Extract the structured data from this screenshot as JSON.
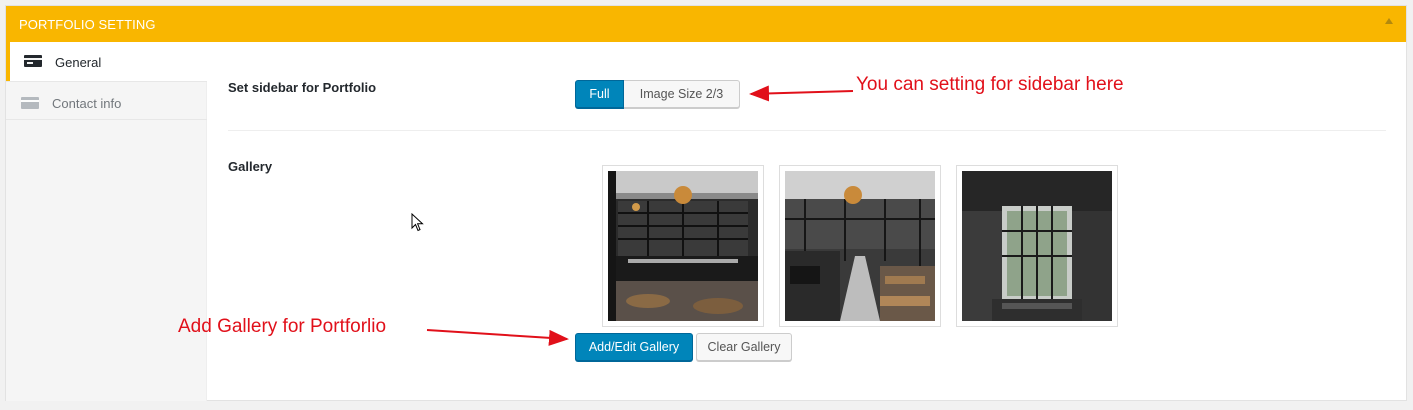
{
  "panel": {
    "title": "PORTFOLIO SETTING",
    "accent_color": "#f9b600",
    "collapse_icon": "triangle-up-icon"
  },
  "sidebar": {
    "tabs": [
      {
        "label": "General",
        "icon": "card-icon",
        "active": true
      },
      {
        "label": "Contact info",
        "icon": "card-icon",
        "active": false
      }
    ]
  },
  "main": {
    "sidebar_setting": {
      "label": "Set sidebar for Portfolio",
      "options": [
        "Full",
        "Image Size 2/3"
      ],
      "selected": "Full"
    },
    "gallery": {
      "label": "Gallery",
      "images": [
        {
          "alt": "restaurant-interior-1"
        },
        {
          "alt": "restaurant-interior-2"
        },
        {
          "alt": "restaurant-interior-3"
        }
      ],
      "add_label": "Add/Edit Gallery",
      "clear_label": "Clear Gallery"
    }
  },
  "annotations": {
    "sidebar_note": "You can setting for sidebar here",
    "gallery_note": "Add Gallery for Portforlio",
    "color": "#e1101a"
  }
}
